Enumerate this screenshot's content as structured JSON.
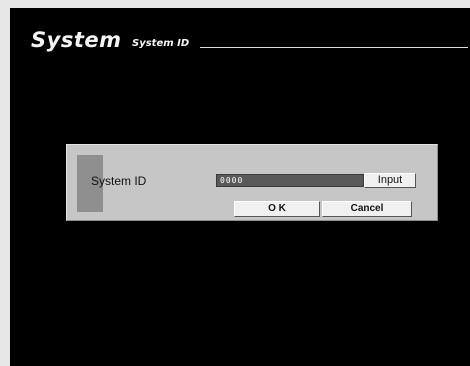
{
  "header": {
    "title": "System",
    "subtitle": "System ID"
  },
  "dialog": {
    "label": "System ID",
    "id_value": "0000",
    "input_button": "Input",
    "ok_button": "O K",
    "cancel_button": "Cancel"
  },
  "colors": {
    "screen_background": "#000000",
    "dialog_background": "#c6c6c6",
    "field_background": "#595959",
    "button_face": "#f0f0f0"
  }
}
